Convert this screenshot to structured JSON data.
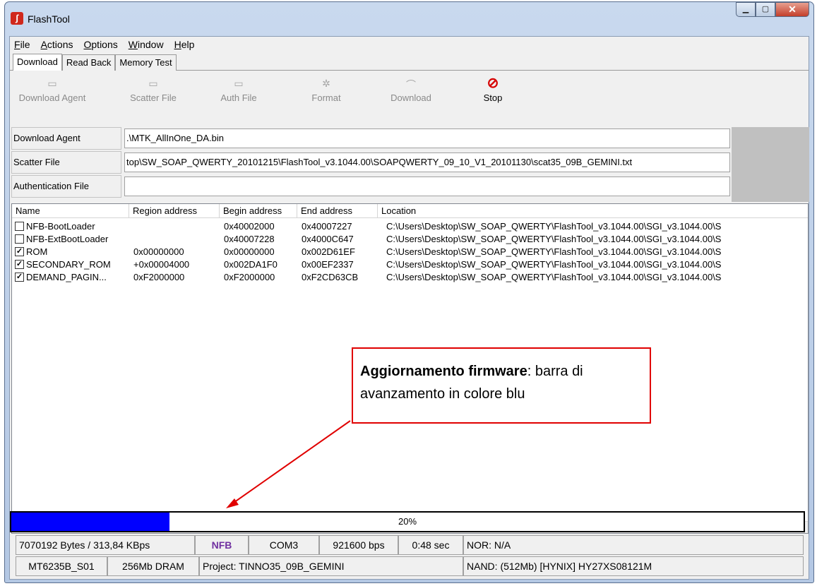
{
  "window": {
    "title": "FlashTool"
  },
  "menu": [
    {
      "label": "File",
      "key": "F",
      "rest": "ile"
    },
    {
      "label": "Actions",
      "key": "A",
      "rest": "ctions"
    },
    {
      "label": "Options",
      "key": "O",
      "rest": "ptions"
    },
    {
      "label": "Window",
      "key": "W",
      "rest": "indow"
    },
    {
      "label": "Help",
      "key": "H",
      "rest": "elp"
    }
  ],
  "tabs": [
    "Download",
    "Read Back",
    "Memory Test"
  ],
  "toolbar": {
    "download_agent": "Download Agent",
    "scatter_file": "Scatter File",
    "auth_file": "Auth File",
    "format": "Format",
    "download": "Download",
    "stop": "Stop"
  },
  "fields": {
    "download_agent_label": "Download Agent",
    "download_agent_value": ".\\MTK_AllInOne_DA.bin",
    "scatter_file_label": "Scatter File",
    "scatter_file_value": "top\\SW_SOAP_QWERTY_20101215\\FlashTool_v3.1044.00\\SOAPQWERTY_09_10_V1_20101130\\scat35_09B_GEMINI.txt",
    "auth_file_label": "Authentication File",
    "auth_file_value": ""
  },
  "list": {
    "headers": [
      "Name",
      "Region address",
      "Begin address",
      "End address",
      "Location"
    ],
    "rows": [
      {
        "checked": false,
        "name": "NFB-BootLoader",
        "region": "",
        "begin": "0x40002000",
        "end": "0x40007227",
        "location": "C:\\Users\\Desktop\\SW_SOAP_QWERTY\\FlashTool_v3.1044.00\\SGI_v3.1044.00\\S"
      },
      {
        "checked": false,
        "name": "NFB-ExtBootLoader",
        "region": "",
        "begin": "0x40007228",
        "end": "0x4000C647",
        "location": "C:\\Users\\Desktop\\SW_SOAP_QWERTY\\FlashTool_v3.1044.00\\SGI_v3.1044.00\\S"
      },
      {
        "checked": true,
        "name": "ROM",
        "region": "0x00000000",
        "begin": "0x00000000",
        "end": "0x002D61EF",
        "location": "C:\\Users\\Desktop\\SW_SOAP_QWERTY\\FlashTool_v3.1044.00\\SGI_v3.1044.00\\S"
      },
      {
        "checked": true,
        "name": "SECONDARY_ROM",
        "region": "+0x00004000",
        "begin": "0x002DA1F0",
        "end": "0x00EF2337",
        "location": "C:\\Users\\Desktop\\SW_SOAP_QWERTY\\FlashTool_v3.1044.00\\SGI_v3.1044.00\\S"
      },
      {
        "checked": true,
        "name": "DEMAND_PAGIN...",
        "region": "0xF2000000",
        "begin": "0xF2000000",
        "end": "0xF2CD63CB",
        "location": "C:\\Users\\Desktop\\SW_SOAP_QWERTY\\FlashTool_v3.1044.00\\SGI_v3.1044.00\\S"
      }
    ]
  },
  "progress": {
    "fraction": 0.2,
    "label": "20%",
    "color": "#0000ff"
  },
  "status_row1": {
    "bytes": "7070192 Bytes / 313,84 KBps",
    "type": "NFB",
    "port": "COM3",
    "baud": "921600 bps",
    "time": "0:48 sec",
    "nor": "NOR: N/A"
  },
  "status_row2": {
    "chip": "MT6235B_S01",
    "dram": "256Mb DRAM",
    "project": "Project: TINNO35_09B_GEMINI",
    "nand": "NAND: (512Mb) [HYNIX] HY27XS08121M"
  },
  "callout": {
    "bold": "Aggiornamento firmware",
    "text": ": barra di avanzamento in colore blu"
  },
  "colors": {
    "accent": "#e00000",
    "progress": "#0000ff",
    "nfb": "#7030a0"
  }
}
